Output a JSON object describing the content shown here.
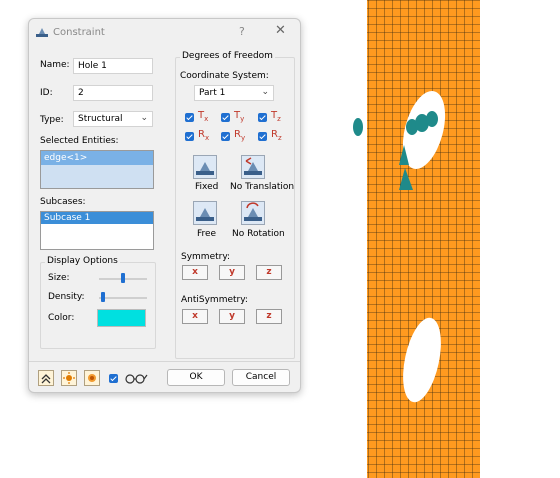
{
  "dialog": {
    "title": "Constraint",
    "help_glyph": "?",
    "close_glyph": "✕",
    "name_label": "Name:",
    "name_value": "Hole 1",
    "id_label": "ID:",
    "id_value": "2",
    "type_label": "Type:",
    "type_value": "Structural",
    "selected_entities_label": "Selected Entities:",
    "selected_entities": [
      "edge<1>"
    ],
    "subcases_label": "Subcases:",
    "subcases": [
      "Subcase 1"
    ],
    "display_options": {
      "title": "Display Options",
      "size_label": "Size:",
      "size_level": 0.5,
      "density_label": "Density:",
      "density_level": 0.05,
      "color_label": "Color:",
      "color_value": "#00e0e0"
    },
    "dof": {
      "title": "Degrees of Freedom",
      "coord_label": "Coordinate System:",
      "coord_value": "Part 1",
      "translations": [
        {
          "letter": "T",
          "sub": "x"
        },
        {
          "letter": "T",
          "sub": "y"
        },
        {
          "letter": "T",
          "sub": "z"
        }
      ],
      "rotations": [
        {
          "letter": "R",
          "sub": "x"
        },
        {
          "letter": "R",
          "sub": "y"
        },
        {
          "letter": "R",
          "sub": "z"
        }
      ],
      "fixed_label": "Fixed",
      "no_translation_label": "No Translation",
      "free_label": "Free",
      "no_rotation_label": "No Rotation",
      "symmetry_label": "Symmetry:",
      "symmetry_buttons": [
        "x",
        "y",
        "z"
      ],
      "antisymmetry_label": "AntiSymmetry:",
      "antisymmetry_buttons": [
        "x",
        "y",
        "z"
      ]
    },
    "ok_label": "OK",
    "cancel_label": "Cancel"
  },
  "colors": {
    "accent": "#1f6fd1",
    "mesh_fill": "#ff9a1f",
    "constraint_marker": "#1f8a8a"
  }
}
